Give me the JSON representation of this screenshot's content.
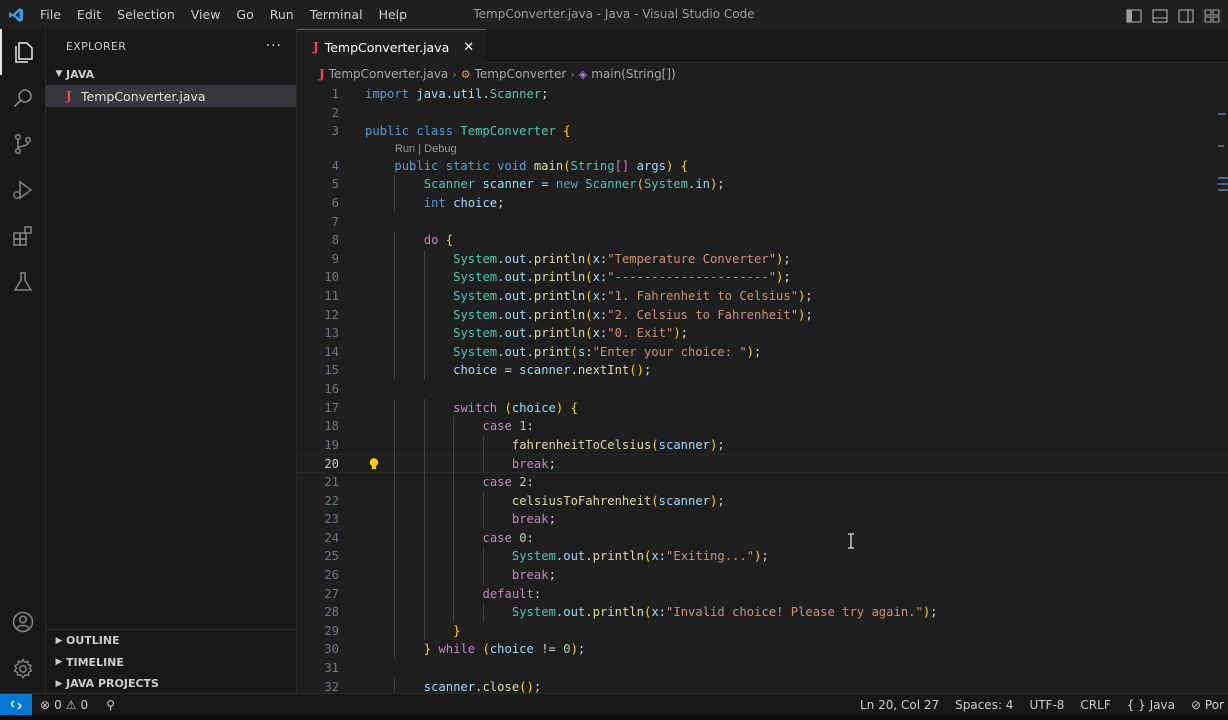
{
  "window": {
    "title": "TempConverter.java - Java - Visual Studio Code",
    "menus": [
      "File",
      "Edit",
      "Selection",
      "View",
      "Go",
      "Run",
      "Terminal",
      "Help"
    ]
  },
  "sidebar": {
    "header": "EXPLORER",
    "more": "···",
    "folder": "JAVA",
    "file": "TempConverter.java",
    "sections": [
      "OUTLINE",
      "TIMELINE",
      "JAVA PROJECTS"
    ]
  },
  "editor": {
    "tab_label": "TempConverter.java",
    "breadcrumb": [
      "TempConverter.java",
      "TempConverter",
      "main(String[])"
    ],
    "codelens": "Run | Debug",
    "current_line": 20
  },
  "code_lines": [
    "import java.util.Scanner;",
    "",
    "public class TempConverter {",
    "    public static void main(String[] args) {",
    "        Scanner scanner = new Scanner(System.in);",
    "        int choice;",
    "",
    "        do {",
    "            System.out.println(x:\"Temperature Converter\");",
    "            System.out.println(x:\"---------------------\");",
    "            System.out.println(x:\"1. Fahrenheit to Celsius\");",
    "            System.out.println(x:\"2. Celsius to Fahrenheit\");",
    "            System.out.println(x:\"0. Exit\");",
    "            System.out.print(s:\"Enter your choice: \");",
    "            choice = scanner.nextInt();",
    "",
    "            switch (choice) {",
    "                case 1:",
    "                    fahrenheitToCelsius(scanner);",
    "                    break;",
    "                case 2:",
    "                    celsiusToFahrenheit(scanner);",
    "                    break;",
    "                case 0:",
    "                    System.out.println(x:\"Exiting...\");",
    "                    break;",
    "                default:",
    "                    System.out.println(x:\"Invalid choice! Please try again.\");",
    "            }",
    "        } while (choice != 0);",
    "",
    "        scanner.close();"
  ],
  "statusbar": {
    "errors": "0",
    "warnings": "0",
    "position": "Ln 20, Col 27",
    "spaces": "Spaces: 4",
    "encoding": "UTF-8",
    "eol": "CRLF",
    "language": "Java",
    "ports": "Por"
  },
  "colors": {
    "accent": "#0078d4",
    "java_icon": "#f44747"
  }
}
